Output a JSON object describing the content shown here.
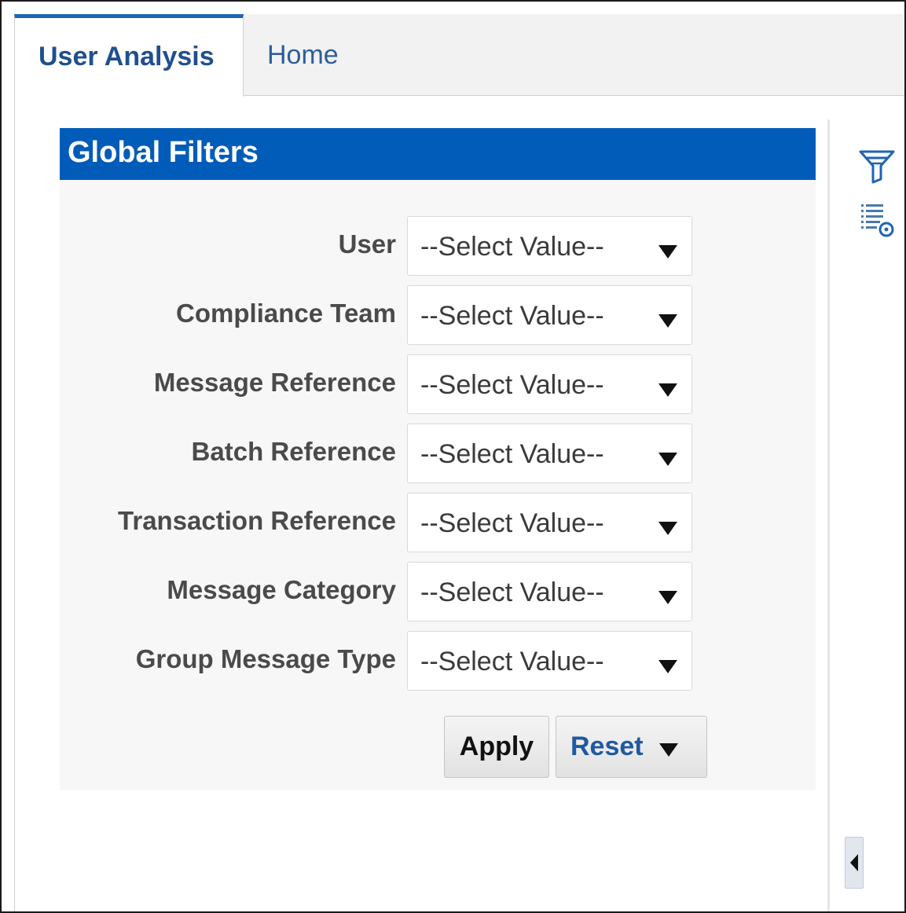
{
  "tabs": [
    {
      "label": "User Analysis",
      "active": true
    },
    {
      "label": "Home",
      "active": false
    }
  ],
  "panel": {
    "title": "Global Filters",
    "header_color": "#005cb8"
  },
  "filters": [
    {
      "label": "User",
      "value": "--Select Value--"
    },
    {
      "label": "Compliance Team",
      "value": "--Select Value--"
    },
    {
      "label": "Message Reference",
      "value": "--Select Value--"
    },
    {
      "label": "Batch Reference",
      "value": "--Select Value--"
    },
    {
      "label": "Transaction Reference",
      "value": "--Select Value--"
    },
    {
      "label": "Message Category",
      "value": "--Select Value--"
    },
    {
      "label": "Group Message Type",
      "value": "--Select Value--"
    }
  ],
  "buttons": {
    "apply_label": "Apply",
    "reset_label": "Reset"
  },
  "side_icons": [
    "filter-icon",
    "list-settings-icon"
  ],
  "collapse": {
    "icon": "chevron-left-icon"
  }
}
